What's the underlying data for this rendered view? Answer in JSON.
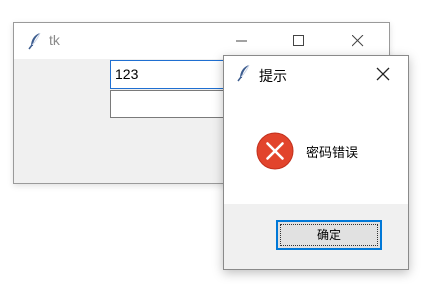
{
  "main_window": {
    "title": "tk",
    "icon": "feather-icon",
    "entry_1_value": "123",
    "entry_2_value": ""
  },
  "dialog": {
    "title": "提示",
    "icon": "feather-icon",
    "status_icon": "error-icon",
    "message": "密码错误",
    "ok_label": "确定"
  },
  "colors": {
    "error_red": "#e2442c",
    "focus_blue": "#0078d7",
    "window_bg": "#f0f0f0"
  }
}
